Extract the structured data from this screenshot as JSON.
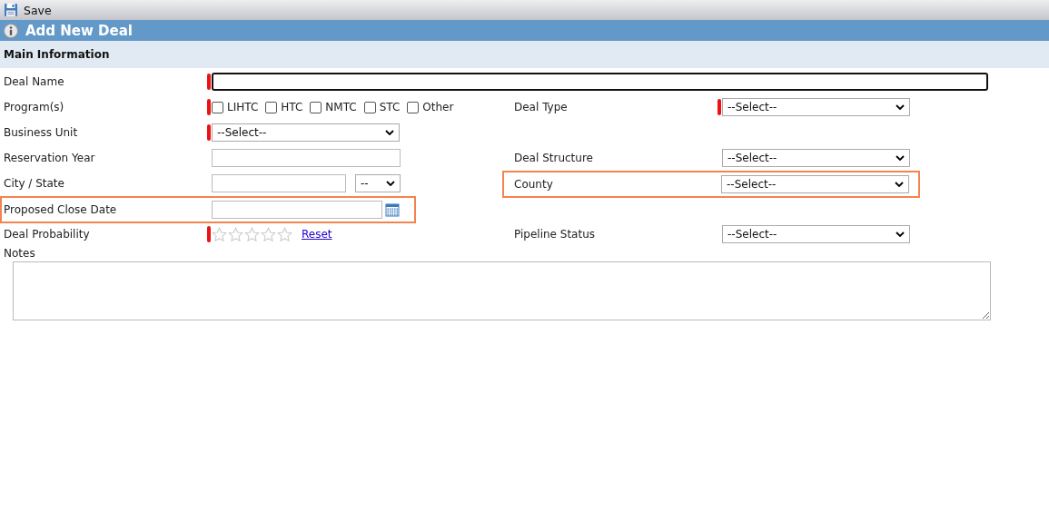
{
  "toolbar": {
    "save_label": "Save"
  },
  "title": "Add New Deal",
  "section": "Main Information",
  "deal_name": {
    "label": "Deal Name",
    "kind": "text",
    "required": true,
    "focused": true
  },
  "rows": [
    {
      "left": {
        "label": "Program(s)",
        "kind": "checkboxes",
        "required": true,
        "highlighted": false,
        "options": [
          {
            "label": "LIHTC",
            "checked": false
          },
          {
            "label": "HTC",
            "checked": false
          },
          {
            "label": "NMTC",
            "checked": false
          },
          {
            "label": "STC",
            "checked": false
          },
          {
            "label": "Other",
            "checked": false
          }
        ]
      },
      "right": {
        "label": "Deal Type",
        "kind": "select",
        "required": true,
        "highlighted": false,
        "value": "--Select--"
      }
    },
    {
      "left": {
        "label": "Business Unit",
        "kind": "select",
        "required": true,
        "highlighted": false,
        "value": "--Select--"
      }
    },
    {
      "left": {
        "label": "Reservation Year",
        "kind": "text",
        "required": false,
        "highlighted": false
      },
      "right": {
        "label": "Deal Structure",
        "kind": "select",
        "required": false,
        "highlighted": false,
        "value": "--Select--"
      }
    },
    {
      "left": {
        "label": "City / State",
        "kind": "city_state",
        "required": false,
        "highlighted": false,
        "state": "--"
      },
      "right": {
        "label": "County",
        "kind": "select",
        "required": false,
        "highlighted": true,
        "value": "--Select--"
      }
    },
    {
      "left": {
        "label": "Proposed Close Date",
        "kind": "date",
        "required": false,
        "highlighted": true
      }
    },
    {
      "left": {
        "label": "Deal Probability",
        "kind": "stars",
        "required": true,
        "highlighted": false,
        "stars": 0,
        "reset": "Reset"
      },
      "right": {
        "label": "Pipeline Status",
        "kind": "select",
        "required": false,
        "highlighted": false,
        "value": "--Select--"
      }
    }
  ],
  "notes": {
    "label": "Notes"
  }
}
